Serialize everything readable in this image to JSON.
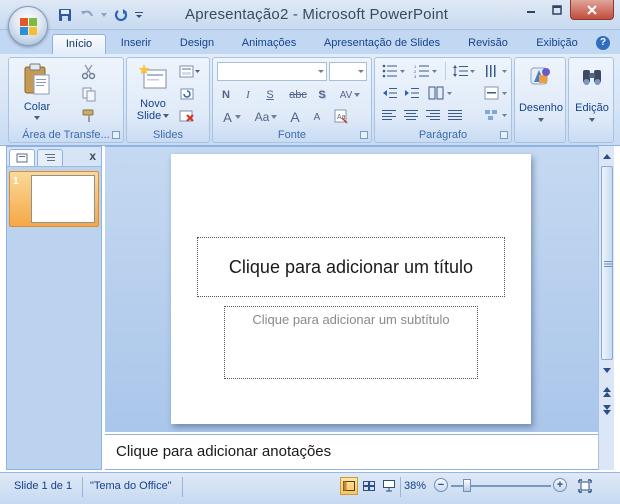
{
  "window": {
    "title": "Apresentação2 - Microsoft PowerPoint",
    "minimize_glyph": "—",
    "maximize_glyph": "□",
    "close_glyph": "✕"
  },
  "tabs": [
    {
      "label": "Início",
      "active": true
    },
    {
      "label": "Inserir"
    },
    {
      "label": "Design"
    },
    {
      "label": "Animações"
    },
    {
      "label": "Apresentação de Slides"
    },
    {
      "label": "Revisão"
    },
    {
      "label": "Exibição"
    }
  ],
  "help_glyph": "?",
  "ribbon": {
    "clipboard": {
      "label": "Área de Transfe...",
      "paste": "Colar"
    },
    "slides": {
      "label": "Slides",
      "new_slide_line1": "Novo",
      "new_slide_line2": "Slide"
    },
    "font": {
      "label": "Fonte",
      "font_name": "",
      "font_size": "",
      "bold": "N",
      "italic": "I",
      "underline": "S",
      "strike": "abc",
      "shadow": "S",
      "spacing": "AV",
      "color": "A",
      "case": "Aa",
      "grow": "A",
      "shrink": "A"
    },
    "paragraph": {
      "label": "Parágrafo"
    },
    "drawing": {
      "label": "Desenho"
    },
    "editing": {
      "label": "Edição"
    }
  },
  "slides_pane": {
    "close_glyph": "x",
    "thumbnails": [
      {
        "number": "1"
      }
    ]
  },
  "slide": {
    "title_placeholder": "Clique para adicionar um título",
    "subtitle_placeholder": "Clique para adicionar um subtítulo"
  },
  "notes": {
    "placeholder": "Clique para adicionar anotações"
  },
  "status": {
    "slide_info": "Slide 1 de 1",
    "theme": "\"Tema do Office\"",
    "zoom": "38%",
    "zoom_fraction": 0.38
  }
}
